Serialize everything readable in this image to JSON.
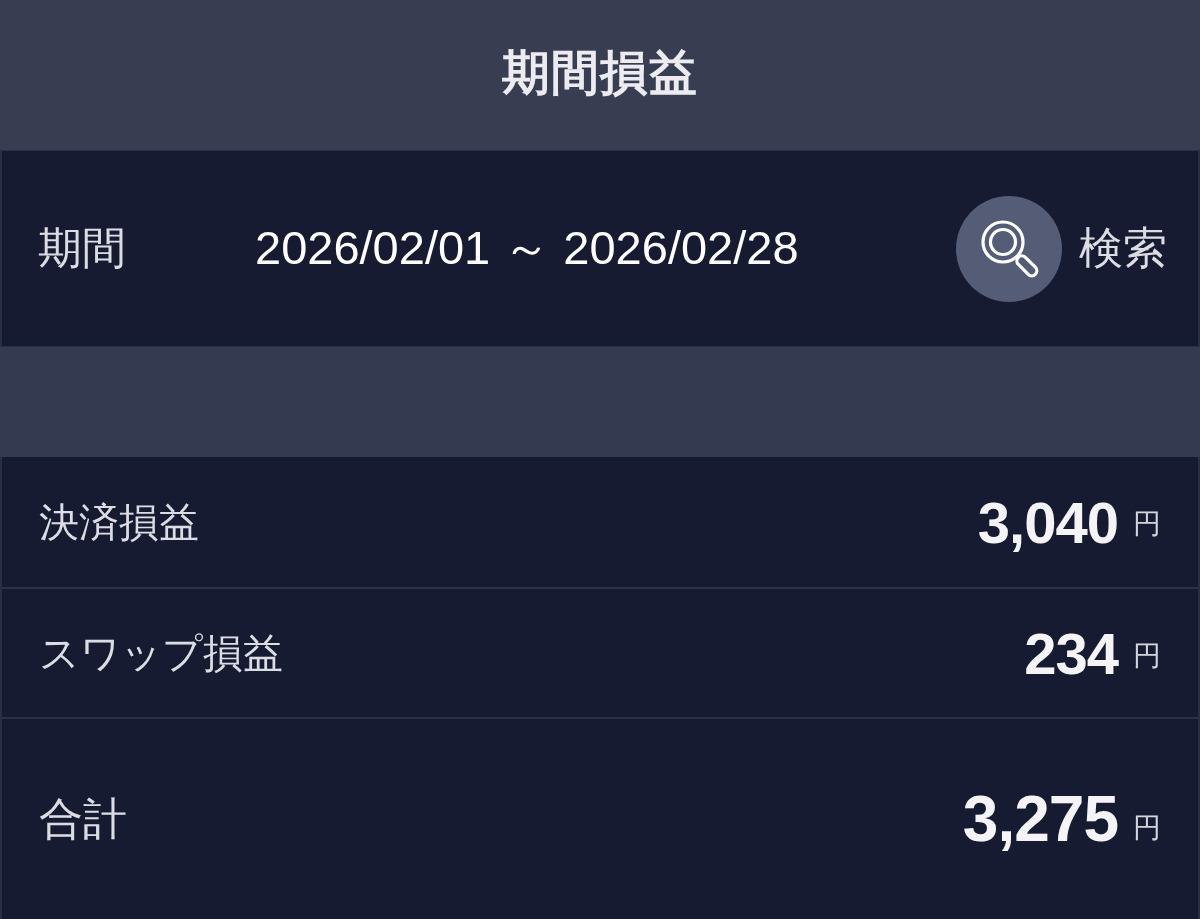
{
  "header": {
    "title": "期間損益"
  },
  "period": {
    "label": "期間",
    "range": "2026/02/01 ～ 2026/02/28",
    "search_button": {
      "label": "検索"
    }
  },
  "rows": [
    {
      "kind": "item",
      "label": "決済損益",
      "value": "3,040",
      "unit": "円"
    },
    {
      "kind": "item",
      "label": "スワップ損益",
      "value": "234",
      "unit": "円"
    },
    {
      "kind": "total",
      "label": "合計",
      "value": "3,275",
      "unit": "円"
    }
  ]
}
